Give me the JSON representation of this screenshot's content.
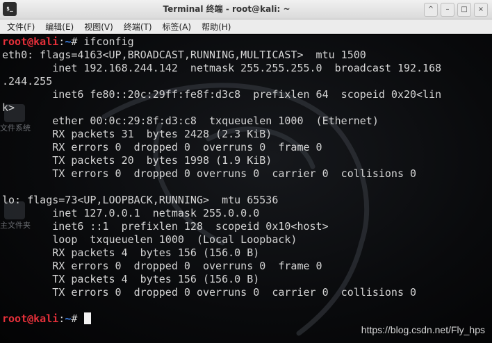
{
  "window": {
    "app_icon_glyph": "$_",
    "title": "Terminal 终端 - root@kali: ~",
    "controls": [
      "^",
      "–",
      "□",
      "×"
    ]
  },
  "menu": [
    "文件(F)",
    "编辑(E)",
    "视图(V)",
    "终端(T)",
    "标签(A)",
    "帮助(H)"
  ],
  "desktop_icons": [
    "文件系统",
    "主文件夹"
  ],
  "prompt": {
    "user": "root@kali",
    "path": "~",
    "symbol": "#"
  },
  "command": " ifconfig",
  "output": [
    "eth0: flags=4163<UP,BROADCAST,RUNNING,MULTICAST>  mtu 1500",
    "        inet 192.168.244.142  netmask 255.255.255.0  broadcast 192.168",
    ".244.255",
    "        inet6 fe80::20c:29ff:fe8f:d3c8  prefixlen 64  scopeid 0x20<lin",
    "k>",
    "        ether 00:0c:29:8f:d3:c8  txqueuelen 1000  (Ethernet)",
    "        RX packets 31  bytes 2428 (2.3 KiB)",
    "        RX errors 0  dropped 0  overruns 0  frame 0",
    "        TX packets 20  bytes 1998 (1.9 KiB)",
    "        TX errors 0  dropped 0 overruns 0  carrier 0  collisions 0",
    "",
    "lo: flags=73<UP,LOOPBACK,RUNNING>  mtu 65536",
    "        inet 127.0.0.1  netmask 255.0.0.0",
    "        inet6 ::1  prefixlen 128  scopeid 0x10<host>",
    "        loop  txqueuelen 1000  (Local Loopback)",
    "        RX packets 4  bytes 156 (156.0 B)",
    "        RX errors 0  dropped 0  overruns 0  frame 0",
    "        TX packets 4  bytes 156 (156.0 B)",
    "        TX errors 0  dropped 0 overruns 0  carrier 0  collisions 0",
    ""
  ],
  "watermark": "https://blog.csdn.net/Fly_hps",
  "colors": {
    "prompt_user": "#e6303a",
    "prompt_path": "#3b7ee0",
    "text": "#d5d5d5"
  }
}
